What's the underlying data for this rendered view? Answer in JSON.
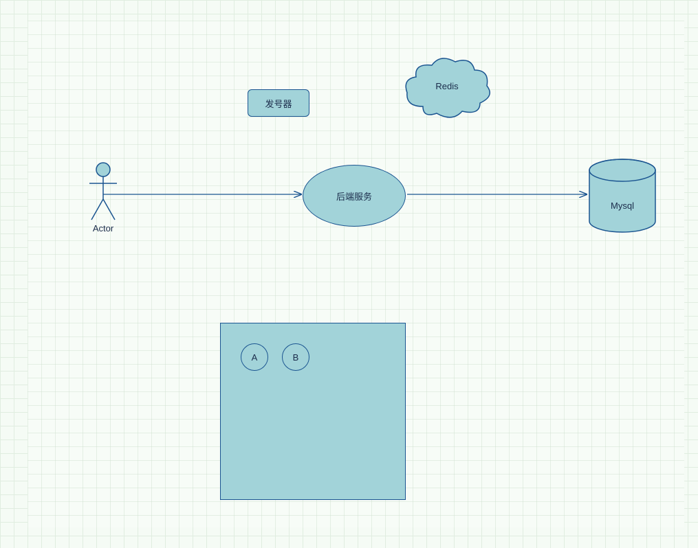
{
  "nodes": {
    "actor_label": "Actor",
    "dispatcher_label": "发号器",
    "redis_label": "Redis",
    "backend_label": "后端服务",
    "db_label": "Mysql",
    "circle_a": "A",
    "circle_b": "B"
  },
  "colors": {
    "fill": "#a2d3d9",
    "stroke": "#1a5490",
    "text": "#1a2b4a"
  },
  "edges": [
    {
      "from": "actor",
      "to": "backend"
    },
    {
      "from": "backend",
      "to": "db"
    }
  ]
}
